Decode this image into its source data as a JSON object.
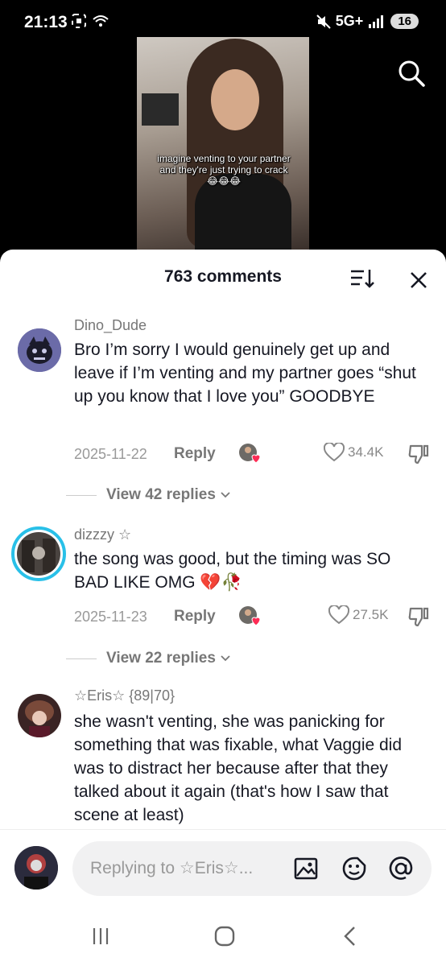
{
  "status_bar": {
    "time": "21:13",
    "network": "5G+",
    "battery": "16"
  },
  "video": {
    "caption": "imagine venting to your partner and they're just trying to crack 😂😂😂"
  },
  "comments_sheet": {
    "title": "763 comments",
    "comments": [
      {
        "username": "Dino_Dude",
        "text": "Bro I’m sorry I would genuinely get up and leave if I’m venting and my partner goes “shut up you know that I love you” GOODBYE",
        "date": "2025-11-22",
        "reply_label": "Reply",
        "likes": "34.4K",
        "view_replies": "View 42 replies"
      },
      {
        "username": "dizzzy ☆",
        "text": "the song was good, but the timing was SO BAD LIKE OMG 💔🥀",
        "date": "2025-11-23",
        "reply_label": "Reply",
        "likes": "27.5K",
        "view_replies": "View 22 replies"
      },
      {
        "username": "☆Eris☆ {89|70}",
        "text": "she wasn't venting, she was panicking for something that was fixable, what Vaggie did was to distract her because after that they talked about it again (that's how I saw that scene at least)"
      }
    ]
  },
  "composer": {
    "placeholder": "Replying to ☆Eris☆..."
  },
  "colors": {
    "text_primary": "#161823",
    "text_secondary": "#777777",
    "story_ring": "#29c0e8",
    "heart_badge": "#fe2c55"
  },
  "icons": [
    "search-icon",
    "sort-icon",
    "close-icon",
    "heart-icon",
    "dislike-icon",
    "image-icon",
    "emoji-icon",
    "mention-icon",
    "recents-icon",
    "home-icon",
    "back-icon"
  ]
}
